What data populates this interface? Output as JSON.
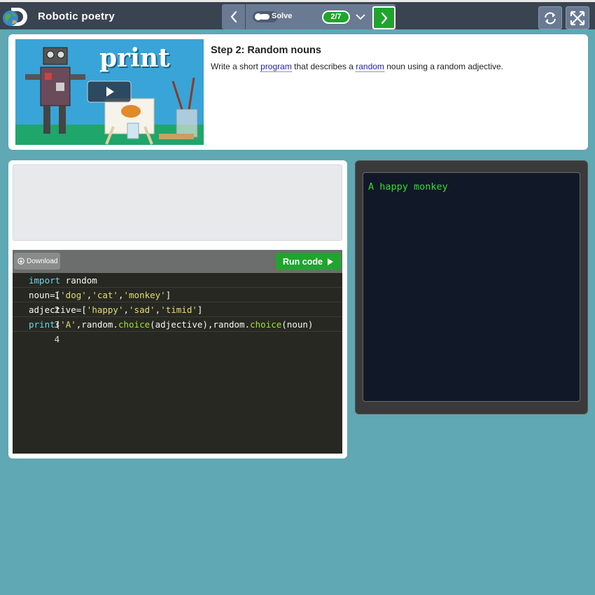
{
  "header": {
    "app_title": "Robotic poetry",
    "logo_icon": "discovery-globe-logo",
    "prev_icon": "chevron-left-icon",
    "solve_label": "Solve",
    "step_progress": "2/7",
    "dropdown_icon": "chevron-down-icon",
    "next_icon": "chevron-right-icon",
    "refresh_icon": "refresh-icon",
    "fullscreen_icon": "fullscreen-icon"
  },
  "step": {
    "video_title": "print",
    "title": "Step 2: Random nouns",
    "desc_part1": "Write a short ",
    "desc_link1": "program",
    "desc_part2": " that describes a ",
    "desc_link2": "random",
    "desc_part3": " noun using a random adjective."
  },
  "editor": {
    "download_label": "Download",
    "run_label": "Run code",
    "lines": [
      {
        "no": "1"
      },
      {
        "no": "2"
      },
      {
        "no": "3"
      },
      {
        "no": "4"
      }
    ],
    "code_tokens": {
      "l1_kw": "import",
      "l1_rest": " random",
      "l2_pre": "noun=[",
      "l2_s1": "'dog'",
      "l2_c1": ",",
      "l2_s2": "'cat'",
      "l2_c2": ",",
      "l2_s3": "'monkey'",
      "l2_post": "]",
      "l3_pre": "adjective=[",
      "l3_s1": "'happy'",
      "l3_c1": ",",
      "l3_s2": "'sad'",
      "l3_c2": ",",
      "l3_s3": "'timid'",
      "l3_post": "]",
      "l4_kw": "print",
      "l4_p1": "(",
      "l4_s1": "'A'",
      "l4_p2": ",random.",
      "l4_f1": "choice",
      "l4_p3": "(adjective),random.",
      "l4_f2": "choice",
      "l4_p4": "(noun)"
    }
  },
  "console": {
    "output": "A happy monkey"
  },
  "colors": {
    "background": "#5fa8b4",
    "topbar": "#3a4350",
    "accent_green": "#1fa52e",
    "console_text": "#33dd33"
  }
}
